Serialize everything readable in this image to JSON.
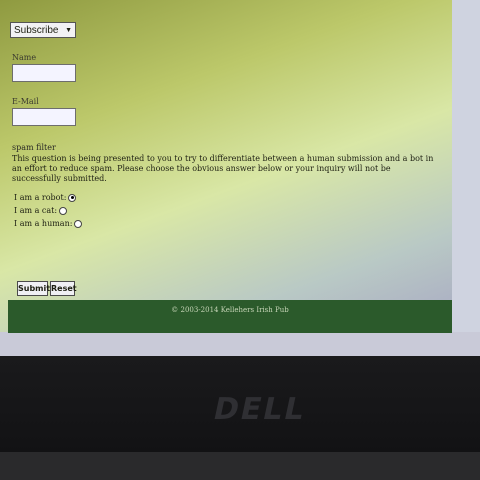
{
  "form": {
    "subscribe_select": {
      "value": "Subscribe"
    },
    "name_label": "Name",
    "email_label": "E-Mail",
    "spam_filter_title": "spam filter",
    "spam_filter_text": "This question is being presented to you to try to differentiate between a human submission and a bot in an effort to reduce spam. Please choose the obvious answer below or your inquiry will not be successfully submitted.",
    "options": [
      {
        "label": "I am a robot:",
        "checked": true
      },
      {
        "label": "I am a cat:",
        "checked": false
      },
      {
        "label": "I am a human:",
        "checked": false
      }
    ],
    "buttons": {
      "submit": "Submit",
      "reset": "Reset"
    }
  },
  "footer": {
    "copyright": "© 2003-2014 Kellehers Irish Pub"
  },
  "device": {
    "logo_text": "DELL"
  }
}
